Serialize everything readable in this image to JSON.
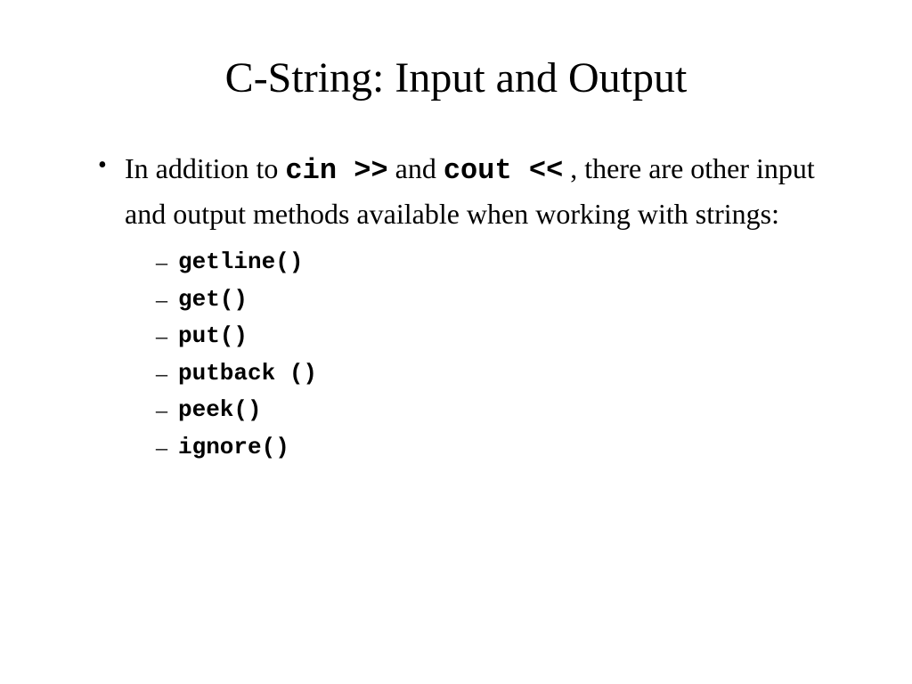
{
  "title": "C-String: Input and Output",
  "bullet": {
    "prefix": "In addition to ",
    "code1": "cin >>",
    "mid1": " and ",
    "code2": "cout <<",
    "suffix": " , there are other input and output methods available when working with strings:"
  },
  "methods": [
    "getline()",
    "get()",
    "put()",
    "putback ()",
    "peek()",
    "ignore()"
  ]
}
